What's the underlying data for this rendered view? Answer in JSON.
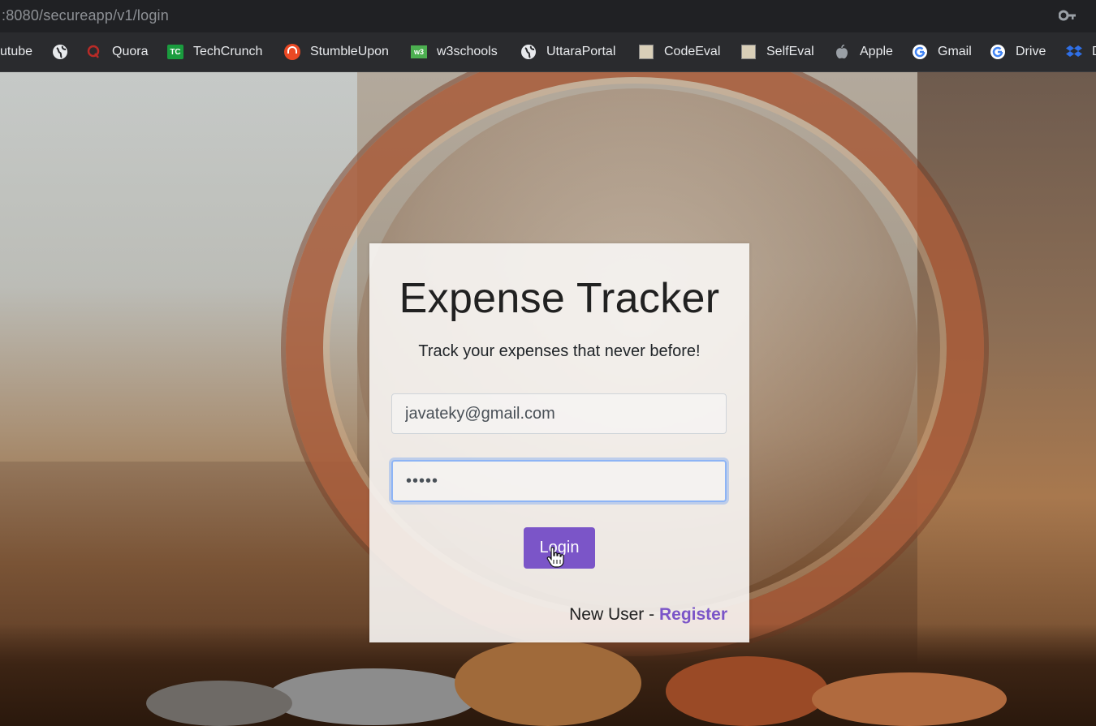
{
  "browser": {
    "url": ":8080/secureapp/v1/login",
    "bookmarks": [
      {
        "label": "utube",
        "icon": "none"
      },
      {
        "label": "",
        "icon": "globe-icon"
      },
      {
        "label": "Quora",
        "icon": "quora-icon"
      },
      {
        "label": "TechCrunch",
        "icon": "techcrunch-icon"
      },
      {
        "label": "StumbleUpon",
        "icon": "stumbleupon-icon"
      },
      {
        "label": "w3schools",
        "icon": "w3schools-icon"
      },
      {
        "label": "UttaraPortal",
        "icon": "globe-icon"
      },
      {
        "label": "CodeEval",
        "icon": "codeeval-icon"
      },
      {
        "label": "SelfEval",
        "icon": "selfeval-icon"
      },
      {
        "label": "Apple",
        "icon": "apple-icon"
      },
      {
        "label": "Gmail",
        "icon": "google-icon"
      },
      {
        "label": "Drive",
        "icon": "google-icon"
      },
      {
        "label": "D",
        "icon": "dropbox-icon"
      }
    ]
  },
  "login": {
    "title": "Expense Tracker",
    "subtitle": "Track your expenses that never before!",
    "email_value": "javateky@gmail.com",
    "password_value": "•••••",
    "login_label": "Login",
    "new_user_label": "New User - ",
    "register_label": "Register"
  },
  "colors": {
    "accent": "#7b55c8",
    "focus_ring": "#8db4f5"
  }
}
